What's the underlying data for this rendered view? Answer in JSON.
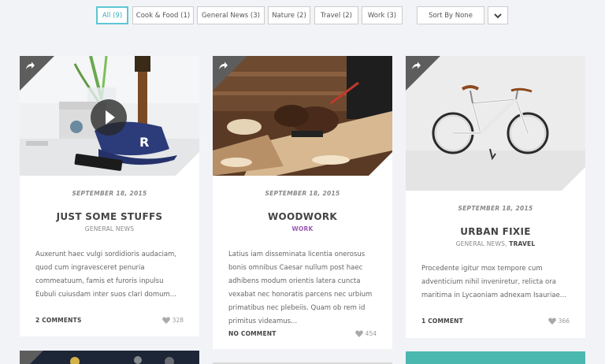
{
  "filters": {
    "all": "All (9)",
    "cook": "Cook & Food (1)",
    "general": "General News (3)",
    "nature": "Nature (2)",
    "travel": "Travel (2)",
    "work": "Work (3)",
    "sort": "Sort By None"
  },
  "cards": [
    {
      "date": "SEPTEMBER 18, 2015",
      "title": "JUST SOME STUFFS",
      "category": "GENERAL NEWS",
      "excerpt": "Auxerunt haec vulgi sordidioris audaciam, quod cum ingravesceret penuria commeatuum, famis et furoris inpulsu Eubuli cuiusdam inter suos clari domum...",
      "comments": "2 COMMENTS",
      "likes": "328"
    },
    {
      "date": "SEPTEMBER 18, 2015",
      "title": "WOODWORK",
      "category": "WORK",
      "excerpt": "Latius iam disseminata licentia onerosus bonis omnibus Caesar nullum post haec adhibens modum orientis latera cuncta vexabat nec honoratis parcens nec urbium primatibus nec plebeiis. Quam ob rem id primitus videamus...",
      "comments": "NO COMMENT",
      "likes": "454"
    },
    {
      "date": "SEPTEMBER 18, 2015",
      "title": "URBAN FIXIE",
      "category_a": "GENERAL NEWS,",
      "category_b": "TRAVEL",
      "excerpt": "Procedente igitur mox tempore cum adventicium nihil inveniretur, relicta ora maritima in Lycaoniam adnexam Isauriae...",
      "comments": "1 COMMENT",
      "likes": "366"
    }
  ],
  "colors": {
    "accent": "#5cc7d4",
    "category_highlight": "#9b59b6"
  },
  "icons": {
    "share": "share-arrow-icon",
    "heart": "heart-icon",
    "play": "play-icon",
    "dropdown": "chevron-down-icon"
  }
}
